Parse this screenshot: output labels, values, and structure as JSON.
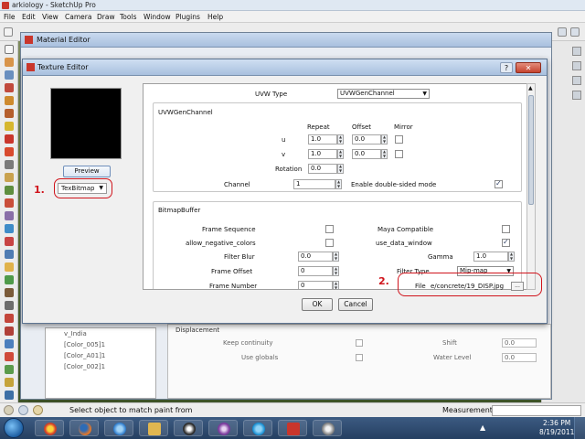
{
  "app": {
    "title": "arkiology - SketchUp Pro",
    "menu": [
      "File",
      "Edit",
      "View",
      "Camera",
      "Draw",
      "Tools",
      "Window",
      "Plugins",
      "Help"
    ]
  },
  "material_editor": {
    "title": "Material Editor",
    "tree_items": [
      "v_India",
      "[Color_005]1",
      "[Color_A01]1",
      "[Color_002]1"
    ],
    "section_title": "Displacement",
    "rows": [
      {
        "label": "Keep continuity",
        "right_label": "Shift",
        "right_value": "0.0"
      },
      {
        "label": "Use globals",
        "right_label": "Water Level",
        "right_value": "0.0"
      }
    ]
  },
  "texture_editor": {
    "title": "Texture Editor",
    "help": "?",
    "close": "✕",
    "preview_button": "Preview",
    "map_type": "TexBitmap",
    "uvw_type_label": "UVW Type",
    "uvw_type_value": "UVWGenChannel",
    "uvw_group": {
      "title": "UVWGenChannel",
      "col_repeat": "Repeat",
      "col_offset": "Offset",
      "col_mirror": "Mirror",
      "u_label": "u",
      "u_repeat": "1.0",
      "u_offset": "0.0",
      "v_label": "v",
      "v_repeat": "1.0",
      "v_offset": "0.0",
      "rotation_label": "Rotation",
      "rotation_value": "0.0",
      "channel_label": "Channel",
      "channel_value": "1",
      "double_sided_label": "Enable double-sided mode",
      "double_sided_checked": true
    },
    "bitmap_group": {
      "title": "BitmapBuffer",
      "frame_sequence_label": "Frame Sequence",
      "maya_compatible_label": "Maya Compatible",
      "allow_negative_label": "allow_negative_colors",
      "use_data_window_label": "use_data_window",
      "use_data_window_checked": true,
      "filter_blur_label": "Filter Blur",
      "filter_blur_value": "0.0",
      "gamma_label": "Gamma",
      "gamma_value": "1.0",
      "frame_offset_label": "Frame Offset",
      "frame_offset_value": "0",
      "filter_type_label": "Filter Type",
      "filter_type_value": "Mip-map",
      "frame_number_label": "Frame Number",
      "frame_number_value": "0",
      "file_label": "File",
      "file_value": "e/concrete/19_DISP.jpg",
      "browse": "..."
    },
    "ok": "OK",
    "cancel": "Cancel"
  },
  "annotations": {
    "one": "1.",
    "two": "2."
  },
  "status": {
    "text": "Select object to match paint from",
    "measurements_label": "Measurements"
  },
  "taskbar": {
    "time": "2:36 PM",
    "date": "8/19/2011"
  },
  "colors": {
    "annotation_red": "#d0141c",
    "dialog_bg": "#f0f0f0",
    "title_gradient": "#a8c0de"
  }
}
